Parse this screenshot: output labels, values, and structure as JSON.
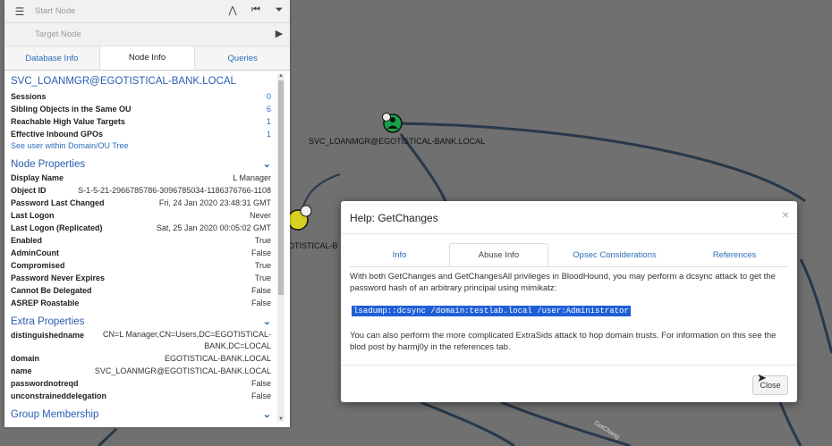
{
  "search": {
    "start_placeholder": "Start Node",
    "target_placeholder": "Target Node"
  },
  "tabs": [
    "Database Info",
    "Node Info",
    "Queries"
  ],
  "node": {
    "title": "SVC_LOANMGR@EGOTISTICAL-BANK.LOCAL",
    "stats": [
      {
        "label": "Sessions",
        "value": "0"
      },
      {
        "label": "Sibling Objects in the Same OU",
        "value": "6"
      },
      {
        "label": "Reachable High Value Targets",
        "value": "1"
      },
      {
        "label": "Effective Inbound GPOs",
        "value": "1"
      }
    ],
    "tree_link": "See user within Domain/OU Tree"
  },
  "node_properties": {
    "heading": "Node Properties",
    "rows": [
      {
        "label": "Display Name",
        "value": "L Manager"
      },
      {
        "label": "Object ID",
        "value": "S-1-5-21-2966785786-3096785034-1186376766-1108"
      },
      {
        "label": "Password Last Changed",
        "value": "Fri, 24 Jan 2020 23:48:31 GMT"
      },
      {
        "label": "Last Logon",
        "value": "Never"
      },
      {
        "label": "Last Logon (Replicated)",
        "value": "Sat, 25 Jan 2020 00:05:02 GMT"
      },
      {
        "label": "Enabled",
        "value": "True"
      },
      {
        "label": "AdminCount",
        "value": "False"
      },
      {
        "label": "Compromised",
        "value": "True"
      },
      {
        "label": "Password Never Expires",
        "value": "True"
      },
      {
        "label": "Cannot Be Delegated",
        "value": "False"
      },
      {
        "label": "ASREP Roastable",
        "value": "False"
      }
    ]
  },
  "extra_properties": {
    "heading": "Extra Properties",
    "rows": [
      {
        "label": "distinguishedname",
        "value": "CN=L Manager,CN=Users,DC=EGOTISTICAL-BANK,DC=LOCAL"
      },
      {
        "label": "domain",
        "value": "EGOTISTICAL-BANK.LOCAL"
      },
      {
        "label": "name",
        "value": "SVC_LOANMGR@EGOTISTICAL-BANK.LOCAL"
      },
      {
        "label": "passwordnotreqd",
        "value": "False"
      },
      {
        "label": "unconstraineddelegation",
        "value": "False"
      }
    ]
  },
  "group_membership": {
    "heading": "Group Membership"
  },
  "graph": {
    "node_label": "SVC_LOANMGR@EGOTISTICAL-BANK.LOCAL",
    "partial_label": "OTISTICAL-B",
    "edge_label": "GetChang"
  },
  "modal": {
    "title": "Help: GetChanges",
    "close_x": "×",
    "tabs": [
      "Info",
      "Abuse Info",
      "Opsec Considerations",
      "References"
    ],
    "paragraph1": "With both GetChanges and GetChangesAll privileges in BloodHound, you may perform a dcsync attack to get the password hash of an arbitrary principal using mimikatz:",
    "command": "lsadump::dcsync /domain:testlab.local /user:Administrator",
    "paragraph2": "You can also perform the more complicated ExtraSids attack to hop domain trusts. For information on this see the blod post by harmj0y in the references tab.",
    "close_button": "Close"
  },
  "colors": {
    "link": "#2a6fbb",
    "user_node": "#17a34a",
    "group_node": "#d8d021",
    "selection": "#1f5fd6"
  },
  "icons": [
    "hamburger-menu-icon",
    "pathfinding-icon",
    "back-icon",
    "filter-icon",
    "play-icon",
    "chevron-down-icon",
    "skull-icon",
    "user-icon",
    "cursor-icon"
  ]
}
